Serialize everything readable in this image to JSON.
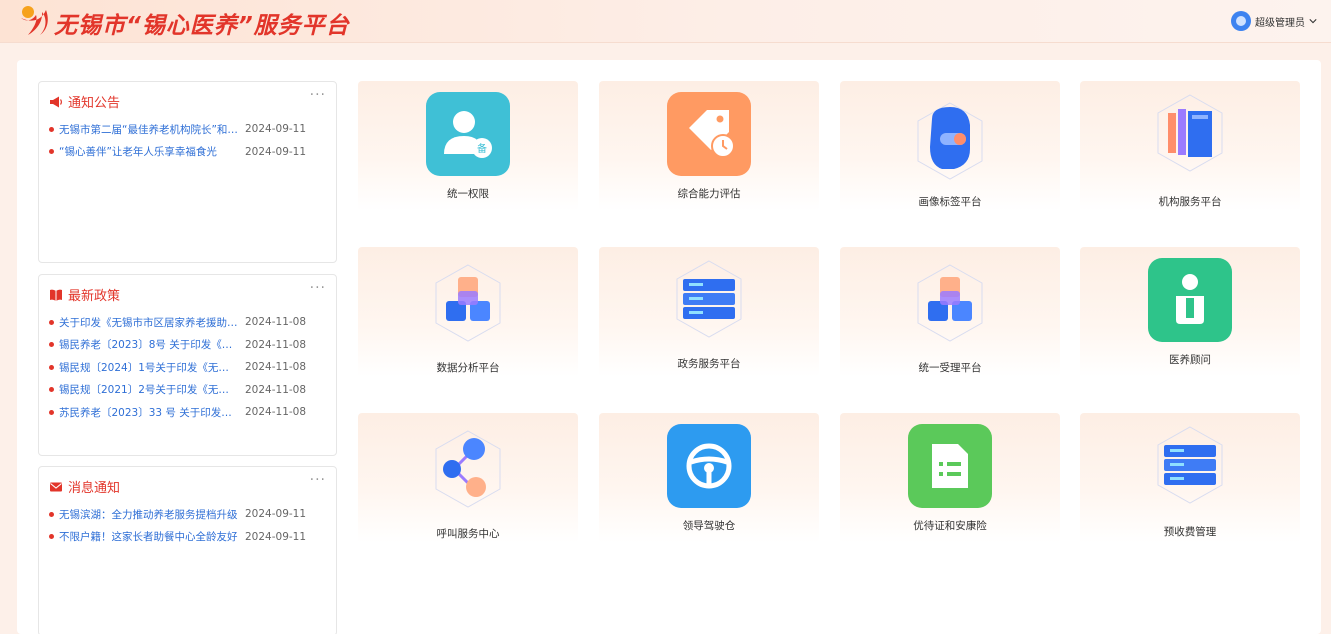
{
  "header": {
    "title": "无锡市“锡心医养”服务平台",
    "user_name": "超级管理员",
    "brand_color": "#e2352a"
  },
  "cards": [
    {
      "title": "通知公告",
      "icon": "megaphone-icon",
      "more": "···",
      "items": [
        {
          "title": "无锡市第二届“最佳养老机构院长”和“…",
          "date": "2024-09-11"
        },
        {
          "title": "“锡心善伴”让老年人乐享幸福食光",
          "date": "2024-09-11"
        }
      ]
    },
    {
      "title": "最新政策",
      "icon": "book-icon",
      "more": "···",
      "items": [
        {
          "title": "关于印发《无锡市市区居家养老援助…",
          "date": "2024-11-08"
        },
        {
          "title": "锡民养老〔2023〕8号 关于印发《无…",
          "date": "2024-11-08"
        },
        {
          "title": "锡民规〔2024〕1号关于印发《无锡…",
          "date": "2024-11-08"
        },
        {
          "title": "锡民规〔2021〕2号关于印发《无锡…",
          "date": "2024-11-08"
        },
        {
          "title": "苏民养老〔2023〕33 号 关于印发《…",
          "date": "2024-11-08"
        }
      ]
    },
    {
      "title": "消息通知",
      "icon": "mail-icon",
      "more": "···",
      "items": [
        {
          "title": "无锡滨湖：全力推动养老服务提档升级",
          "date": "2024-09-11"
        },
        {
          "title": "不限户籍！这家长者助餐中心全龄友好",
          "date": "2024-09-11"
        }
      ]
    }
  ],
  "tiles": [
    {
      "label": "统一权限",
      "icon": "user-badge-icon",
      "color": "#3fc0d6"
    },
    {
      "label": "综合能力评估",
      "icon": "tag-clock-icon",
      "color": "#ff9a62"
    },
    {
      "label": "画像标签平台",
      "icon": "portrait-3d-icon",
      "color": "#2f6ef0"
    },
    {
      "label": "机构服务平台",
      "icon": "books-3d-icon",
      "color": "#2f6ef0"
    },
    {
      "label": "数据分析平台",
      "icon": "cubes-3d-icon",
      "color": "#2f6ef0"
    },
    {
      "label": "政务服务平台",
      "icon": "server-3d-icon",
      "color": "#2f6ef0"
    },
    {
      "label": "统一受理平台",
      "icon": "cubes-3d-icon",
      "color": "#2f6ef0"
    },
    {
      "label": "医养顾问",
      "icon": "info-person-icon",
      "color": "#2ec48a"
    },
    {
      "label": "呼叫服务中心",
      "icon": "molecule-3d-icon",
      "color": "#2f6ef0"
    },
    {
      "label": "领导驾驶仓",
      "icon": "steering-wheel-icon",
      "color": "#2d9bf0"
    },
    {
      "label": "优待证和安康险",
      "icon": "document-list-icon",
      "color": "#5bc95a"
    },
    {
      "label": "预收费管理",
      "icon": "server-3d-icon",
      "color": "#2f6ef0"
    }
  ]
}
